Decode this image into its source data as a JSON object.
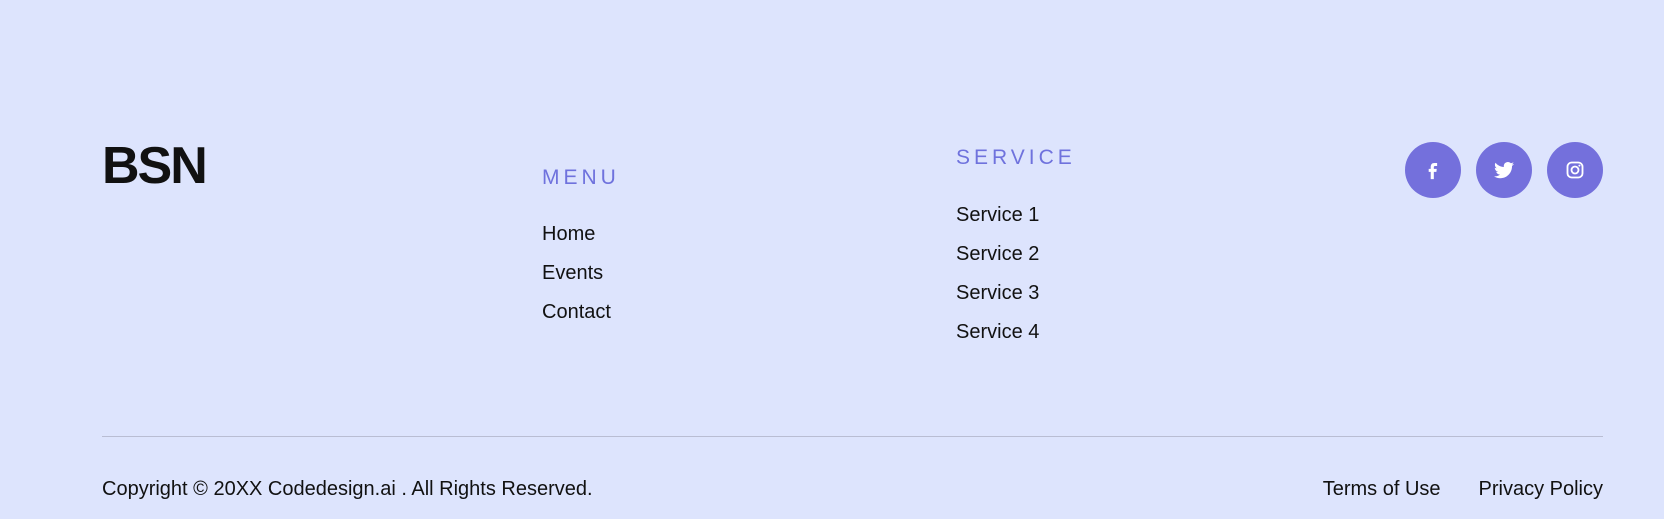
{
  "brand": {
    "name": "BSN"
  },
  "menu": {
    "title": "MENU",
    "items": [
      "Home",
      "Events",
      "Contact"
    ]
  },
  "service": {
    "title": "SERVICE",
    "items": [
      "Service 1",
      "Service 2",
      "Service 3",
      "Service 4"
    ]
  },
  "socials": [
    {
      "icon": "facebook-icon"
    },
    {
      "icon": "twitter-icon"
    },
    {
      "icon": "instagram-icon"
    }
  ],
  "footer_bottom": {
    "copyright": "Copyright © 20XX Codedesign.ai . All Rights Reserved.",
    "terms": "Terms of Use",
    "privacy": "Privacy Policy"
  },
  "colors": {
    "background": "#dde4fd",
    "accent": "#7470dc",
    "heading_accent": "#6f72dd",
    "text": "#111111"
  }
}
